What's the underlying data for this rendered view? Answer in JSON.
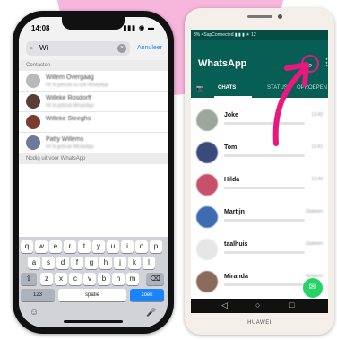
{
  "colors": {
    "pink": "#f7b6dc",
    "whatsapp_green": "#075e54",
    "ios_blue": "#1a84ff",
    "annotation_magenta": "#e8187d"
  },
  "iphone": {
    "time": "14:08",
    "status_icons": "▮▮▮ ◉ ▬",
    "search": {
      "value": "Wi",
      "cancel": "Annuleer",
      "icon": "magnifier-icon"
    },
    "section_contacts": "Contacten",
    "contacts": [
      {
        "name": "Willem Overgaag",
        "sub": "Hi! Ik gebruik nu ook WhatsApp"
      },
      {
        "name": "Willeke Rosdorff",
        "sub": "Hi! Ik gebruik WhatsApp"
      },
      {
        "name": "Willeke Steeghs",
        "sub": ""
      },
      {
        "name": "Patty Willems",
        "sub": "Hi! Ik gebruik WhatsApp"
      }
    ],
    "section_invite": "Nodig uit voor WhatsApp",
    "keyboard": {
      "row1": [
        "q",
        "w",
        "e",
        "r",
        "t",
        "y",
        "u",
        "i",
        "o",
        "p"
      ],
      "row2": [
        "a",
        "s",
        "d",
        "f",
        "g",
        "h",
        "j",
        "k",
        "l"
      ],
      "row3": [
        "z",
        "x",
        "c",
        "v",
        "b",
        "n",
        "m"
      ],
      "num": "123",
      "space": "spatie",
      "go": "zoek",
      "shift": "⇧",
      "delete": "⌫",
      "emoji": "☺",
      "mic": "🎤"
    }
  },
  "huawei": {
    "status_text": "3% 4SapConnected ▮ ▮ ▮ ☀ 12",
    "title": "WhatsApp",
    "menu": "⋮",
    "tabs": {
      "camera": "📷",
      "chats": "CHATS",
      "status": "STATUS",
      "calls": "OPROEPEN"
    },
    "chats": [
      {
        "name": "Joke",
        "time": "13:42",
        "color": "#9aa79a"
      },
      {
        "name": "Tom",
        "time": "13:41",
        "color": "#3a4a7a"
      },
      {
        "name": "Hilda",
        "time": "13:40",
        "color": "#c8506a"
      },
      {
        "name": "Martijn",
        "time": "Gisteren",
        "color": "#3f6bb0"
      },
      {
        "name": "taalhuis",
        "time": "Gisteren",
        "color": "#e6e6e6"
      },
      {
        "name": "Miranda",
        "time": "Gisteren",
        "color": "#8a6a5a"
      }
    ],
    "fab_icon": "✉",
    "nav": [
      "◁",
      "○",
      "□"
    ],
    "brand": "HUAWEI"
  }
}
